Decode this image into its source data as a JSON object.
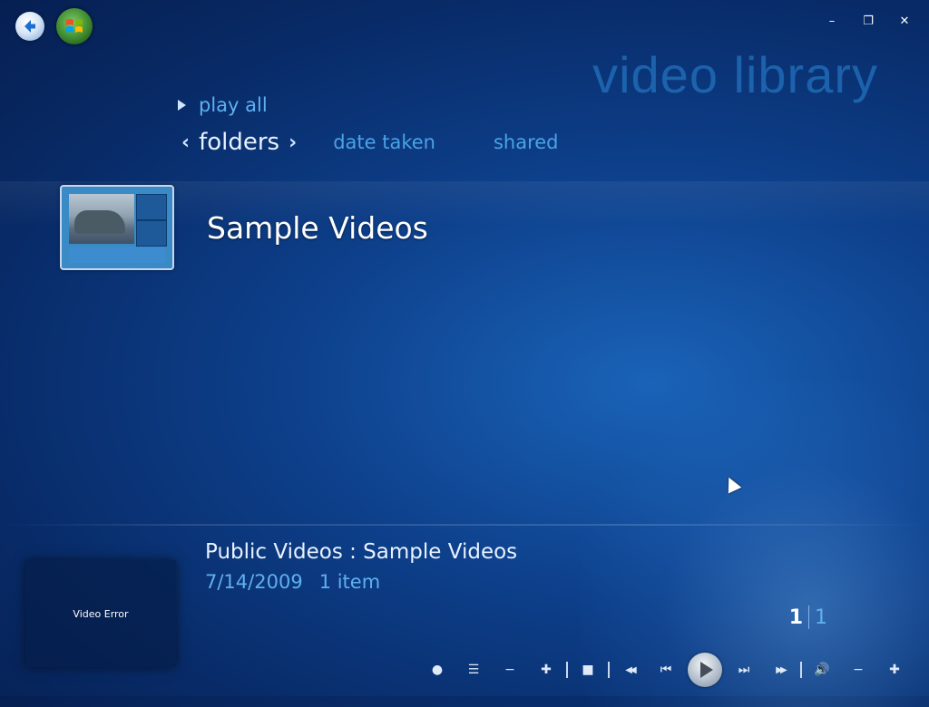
{
  "window": {
    "title": "video library",
    "controls": {
      "minimize": "–",
      "restore": "❐",
      "close": "✕"
    }
  },
  "nav": {
    "back_icon": "back-arrow-icon",
    "start_icon": "windows-start-icon"
  },
  "actions": {
    "play_all": "play all"
  },
  "views": {
    "selected": "folders",
    "left_chevron": "‹",
    "right_chevron": "›",
    "tabs": [
      "date taken",
      "shared"
    ]
  },
  "library": {
    "items": [
      {
        "label": "Sample Videos",
        "type": "folder"
      }
    ]
  },
  "preview": {
    "status": "Video Error"
  },
  "details": {
    "path": "Public Videos : Sample Videos",
    "date": "7/14/2009",
    "count": "1 item"
  },
  "pager": {
    "current": "1",
    "total": "1"
  },
  "transport": {
    "record": "●",
    "guide": "☰",
    "channel_down": "−",
    "channel_up": "✚",
    "stop": "■",
    "rewind": "◀◀",
    "prev": "⏮",
    "next": "⏭",
    "fast_forward": "▶▶",
    "mute": "🔊",
    "vol_down": "−",
    "vol_up": "✚"
  },
  "colors": {
    "bg_dark": "#061f52",
    "bg_mid": "#0d3f8a",
    "accent": "#5fb0f0",
    "title": "#1f6ab5"
  }
}
